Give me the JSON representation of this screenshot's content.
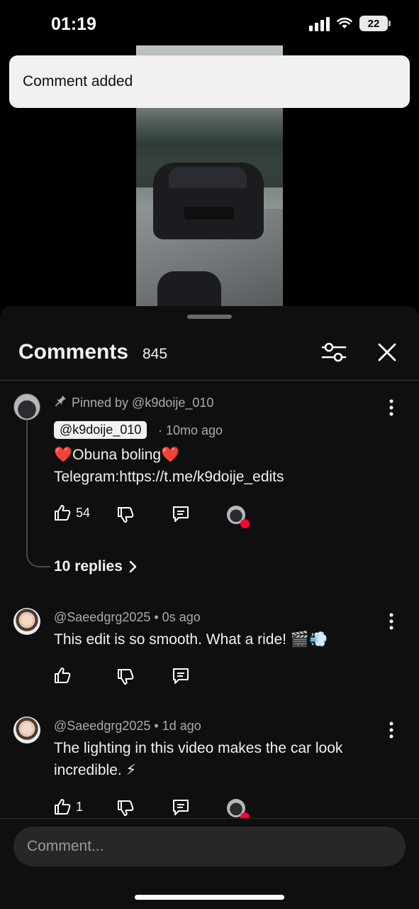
{
  "status_bar": {
    "time": "01:19",
    "battery": "22"
  },
  "toast": {
    "text": "Comment added"
  },
  "panel": {
    "title": "Comments",
    "count": "845"
  },
  "comments": [
    {
      "pinned_label": "Pinned by @k9doije_010",
      "handle": "@k9doije_010",
      "time": "· 10mo ago",
      "text_line1": "❤️Obuna boling❤️",
      "text_line2": "Telegram:https://t.me/k9doije_edits",
      "likes": "54",
      "replies": "10 replies"
    },
    {
      "meta": "@Saeedgrg2025 • 0s ago",
      "text": "This edit is so smooth. What a ride! 🎬💨",
      "likes": ""
    },
    {
      "meta": "@Saeedgrg2025 • 1d ago",
      "text_line1": "The lighting in this video makes the car look",
      "text_line2": "incredible. ⚡",
      "likes": "1"
    }
  ],
  "input": {
    "placeholder": "Comment..."
  },
  "colors": {
    "background": "#0f0f0f",
    "accent_heart": "#ff0033",
    "toast_bg": "#f1f1f1"
  }
}
